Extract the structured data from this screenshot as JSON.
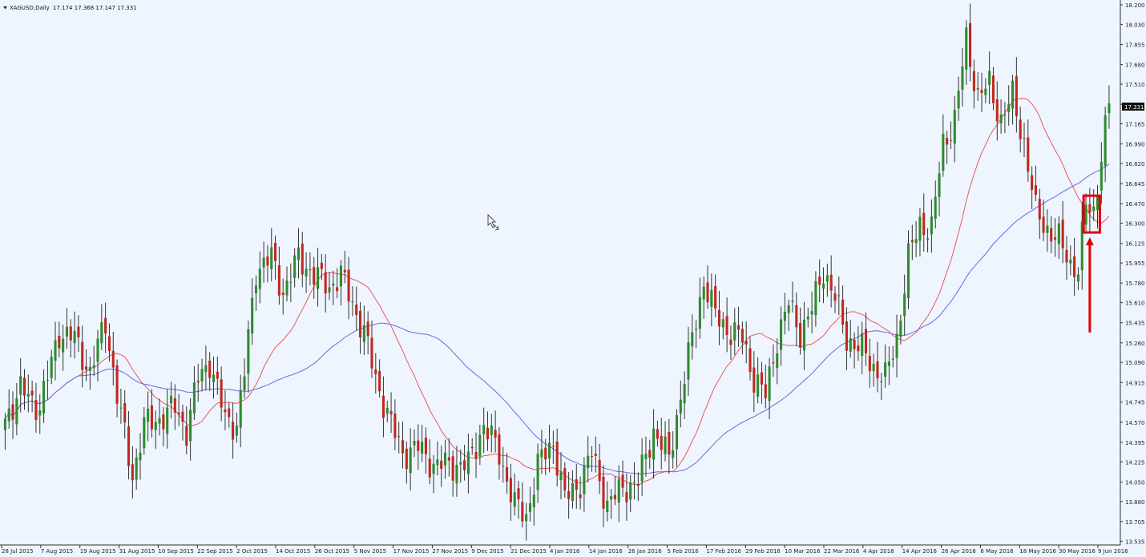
{
  "window": {
    "symbol_label": "XAGUSD,Daily",
    "ohlc_label": "17.174 17.368 17.147 17.331",
    "current_price": "17.331",
    "menu_icon": "triangle-down-icon",
    "cursor_icon": "mouse-pointer-icon"
  },
  "colors": {
    "background": "#eef5ff",
    "bull": "#2e8b2e",
    "bear": "#c0281e",
    "ma_fast": "#e85a5a",
    "ma_slow": "#6a6ad8",
    "highlight": "#e00000",
    "axis": "#333333",
    "price_tag_bg": "#111111"
  },
  "chart_data": {
    "type": "candlestick",
    "title": "XAGUSD,Daily",
    "ylim": [
      13.53,
      18.2
    ],
    "y_ticks": [
      "18.200",
      "18.030",
      "17.855",
      "17.680",
      "17.510",
      "17.335",
      "17.165",
      "16.990",
      "16.820",
      "16.645",
      "16.470",
      "16.300",
      "16.125",
      "15.955",
      "15.780",
      "15.610",
      "15.435",
      "15.260",
      "15.090",
      "14.915",
      "14.745",
      "14.570",
      "14.395",
      "14.225",
      "14.050",
      "13.880",
      "13.705",
      "13.535"
    ],
    "x_ticks": [
      "28 Jul 2015",
      "7 Aug 2015",
      "19 Aug 2015",
      "31 Aug 2015",
      "10 Sep 2015",
      "22 Sep 2015",
      "2 Oct 2015",
      "14 Oct 2015",
      "26 Oct 2015",
      "5 Nov 2015",
      "17 Nov 2015",
      "27 Nov 2015",
      "9 Dec 2015",
      "21 Dec 2015",
      "4 Jan 2016",
      "14 Jan 2016",
      "26 Jan 2016",
      "5 Feb 2016",
      "17 Feb 2016",
      "29 Feb 2016",
      "10 Mar 2016",
      "22 Mar 2016",
      "4 Apr 2016",
      "14 Apr 2016",
      "26 Apr 2016",
      "6 May 2016",
      "18 May 2016",
      "30 May 2016",
      "9 Jun 2016"
    ],
    "close_anchors": [
      [
        0,
        14.6
      ],
      [
        4,
        14.85
      ],
      [
        9,
        14.7
      ],
      [
        14,
        15.35
      ],
      [
        18,
        15.3
      ],
      [
        22,
        15.0
      ],
      [
        26,
        15.45
      ],
      [
        29,
        14.8
      ],
      [
        33,
        14.1
      ],
      [
        36,
        14.55
      ],
      [
        40,
        14.6
      ],
      [
        44,
        14.7
      ],
      [
        47,
        14.5
      ],
      [
        50,
        14.95
      ],
      [
        53,
        15.1
      ],
      [
        57,
        14.6
      ],
      [
        60,
        14.55
      ],
      [
        62,
        15.0
      ],
      [
        65,
        15.9
      ],
      [
        69,
        16.0
      ],
      [
        72,
        15.7
      ],
      [
        76,
        16.0
      ],
      [
        80,
        15.85
      ],
      [
        84,
        15.75
      ],
      [
        87,
        15.85
      ],
      [
        90,
        15.6
      ],
      [
        93,
        15.35
      ],
      [
        96,
        14.95
      ],
      [
        100,
        14.55
      ],
      [
        103,
        14.3
      ],
      [
        107,
        14.35
      ],
      [
        111,
        14.2
      ],
      [
        116,
        14.2
      ],
      [
        120,
        14.2
      ],
      [
        124,
        14.55
      ],
      [
        128,
        14.3
      ],
      [
        132,
        13.85
      ],
      [
        135,
        13.75
      ],
      [
        138,
        14.2
      ],
      [
        142,
        14.4
      ],
      [
        145,
        13.9
      ],
      [
        149,
        14.05
      ],
      [
        152,
        14.3
      ],
      [
        156,
        13.85
      ],
      [
        160,
        14.0
      ],
      [
        164,
        14.05
      ],
      [
        168,
        14.5
      ],
      [
        172,
        14.25
      ],
      [
        175,
        14.8
      ],
      [
        178,
        15.3
      ],
      [
        181,
        15.8
      ],
      [
        184,
        15.5
      ],
      [
        188,
        15.35
      ],
      [
        191,
        15.3
      ],
      [
        194,
        14.95
      ],
      [
        197,
        14.8
      ],
      [
        200,
        15.3
      ],
      [
        203,
        15.6
      ],
      [
        206,
        15.35
      ],
      [
        209,
        15.55
      ],
      [
        212,
        15.9
      ],
      [
        215,
        15.65
      ],
      [
        218,
        15.3
      ],
      [
        222,
        15.2
      ],
      [
        225,
        15.05
      ],
      [
        228,
        14.95
      ],
      [
        231,
        15.3
      ],
      [
        234,
        16.0
      ],
      [
        237,
        16.3
      ],
      [
        240,
        16.25
      ],
      [
        243,
        17.0
      ],
      [
        246,
        17.2
      ],
      [
        249,
        17.9
      ],
      [
        252,
        17.4
      ],
      [
        255,
        17.5
      ],
      [
        258,
        17.2
      ],
      [
        261,
        17.4
      ],
      [
        264,
        17.0
      ],
      [
        267,
        16.4
      ],
      [
        270,
        16.25
      ],
      [
        273,
        16.15
      ],
      [
        276,
        15.95
      ],
      [
        278,
        15.9
      ],
      [
        280,
        16.45
      ],
      [
        282,
        16.4
      ],
      [
        284,
        16.9
      ],
      [
        286,
        17.33
      ]
    ],
    "series": [
      {
        "name": "",
        "period": 20,
        "color": "#e85a5a"
      },
      {
        "name": "",
        "period": 50,
        "color": "#6a6ad8"
      }
    ],
    "annotations": {
      "highlight_box_bars": [
        280,
        283
      ],
      "arrow_points_to_bar": 281
    }
  }
}
